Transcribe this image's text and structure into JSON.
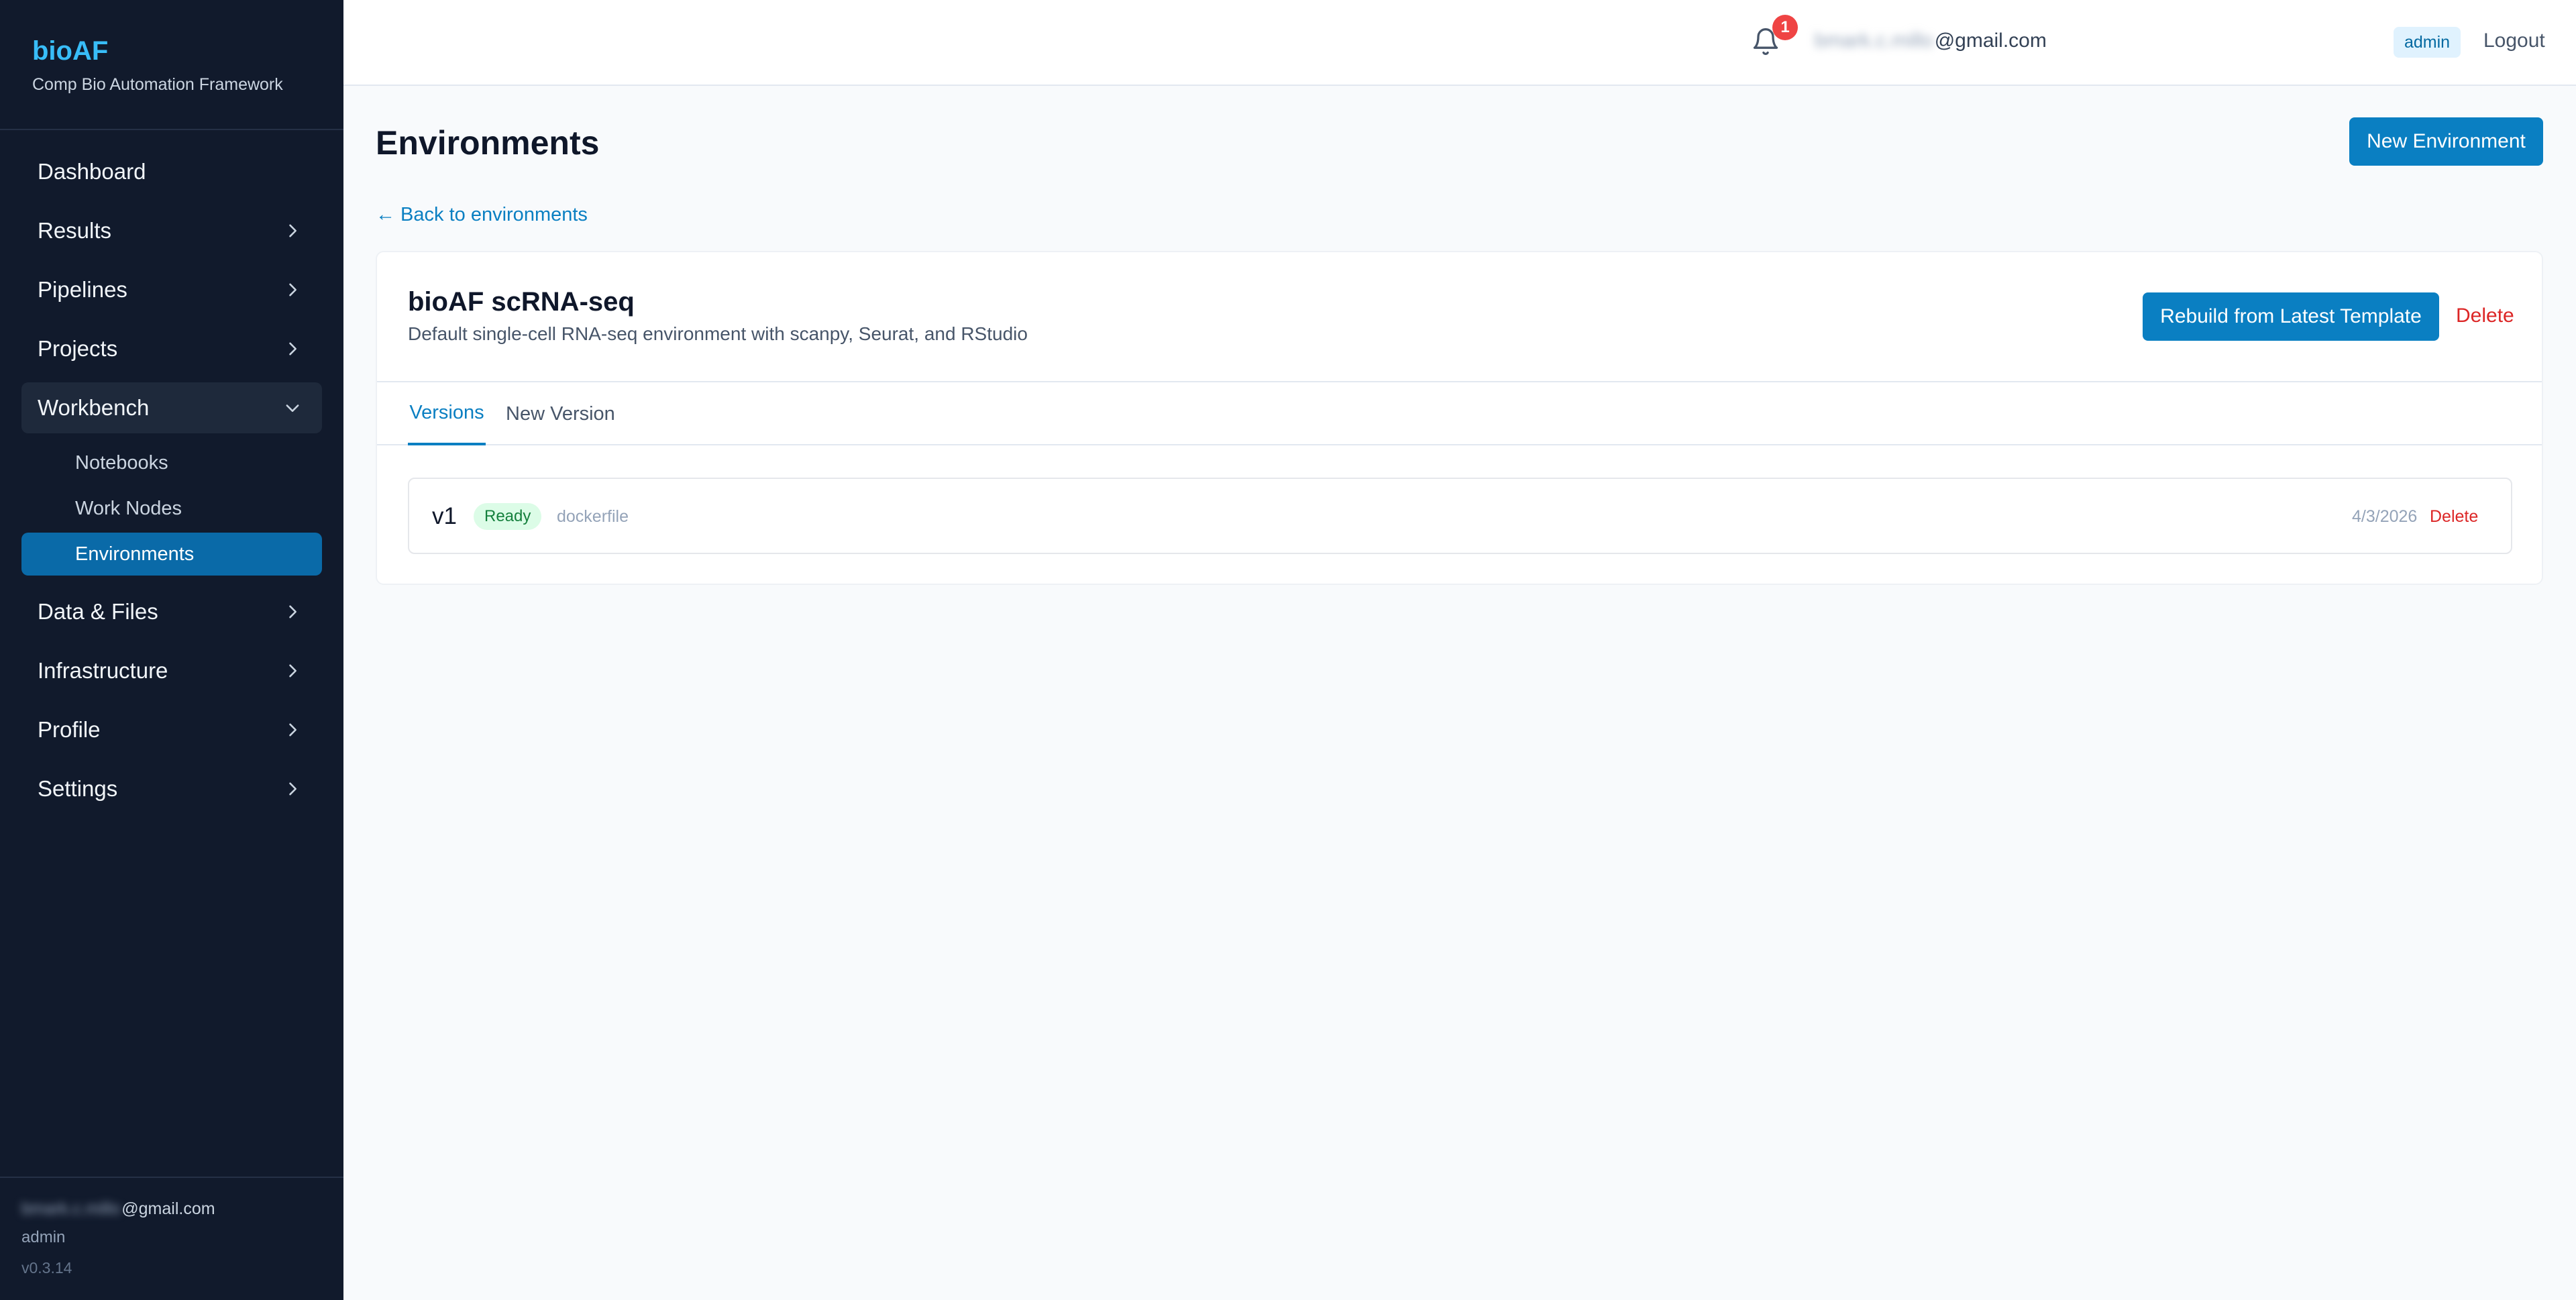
{
  "brand": {
    "title": "bioAF",
    "subtitle": "Comp Bio Automation Framework",
    "accent": "#38bdf8"
  },
  "sidebar": {
    "items": [
      {
        "label": "Dashboard",
        "icon": "none"
      },
      {
        "label": "Results",
        "icon": "chevron-right-icon"
      },
      {
        "label": "Pipelines",
        "icon": "chevron-right-icon"
      },
      {
        "label": "Projects",
        "icon": "chevron-right-icon"
      },
      {
        "label": "Workbench",
        "icon": "chevron-down-icon",
        "expanded": true,
        "children": [
          {
            "label": "Notebooks"
          },
          {
            "label": "Work Nodes"
          },
          {
            "label": "Environments",
            "active": true
          }
        ]
      },
      {
        "label": "Data & Files",
        "icon": "chevron-right-icon"
      },
      {
        "label": "Infrastructure",
        "icon": "chevron-right-icon"
      },
      {
        "label": "Profile",
        "icon": "chevron-right-icon"
      },
      {
        "label": "Settings",
        "icon": "chevron-right-icon"
      }
    ],
    "footer": {
      "email_blurred": "bmark.c.millo",
      "email_domain": "@gmail.com",
      "role": "admin",
      "version": "v0.3.14"
    }
  },
  "header": {
    "notification_count": "1",
    "email_blurred": "bmark.c.millo",
    "email_domain": "@gmail.com",
    "role_badge": "admin",
    "logout": "Logout"
  },
  "main": {
    "title": "Environments",
    "new_button": "New Environment",
    "back_link": "← Back to environments",
    "environment": {
      "name": "bioAF scRNA-seq",
      "description": "Default single-cell RNA-seq environment with scanpy, Seurat, and RStudio",
      "rebuild_button": "Rebuild from Latest Template",
      "delete_link": "Delete"
    },
    "tabs": [
      {
        "label": "Versions",
        "active": true
      },
      {
        "label": "New Version"
      }
    ],
    "versions": [
      {
        "name": "v1",
        "status": "Ready",
        "source": "dockerfile",
        "date": "4/3/2026",
        "delete": "Delete"
      }
    ]
  },
  "colors": {
    "primary": "#0a7fc2",
    "sidebar_bg": "#111a2c",
    "danger": "#dc2626",
    "success": "#15803d"
  }
}
